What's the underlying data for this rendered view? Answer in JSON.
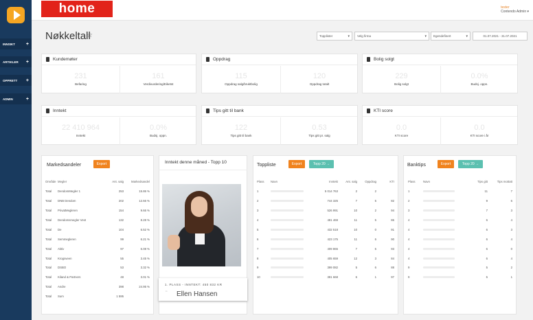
{
  "brand": "home",
  "user": {
    "line1": "tester",
    "line2": "Contendo Admin ▾"
  },
  "sidebar": {
    "items": [
      {
        "label": "INNSIKT",
        "plus": "+"
      },
      {
        "label": "ARTIKLER",
        "plus": "+"
      },
      {
        "label": "OPPRETT",
        "plus": "+"
      },
      {
        "label": "ADMIN",
        "plus": "+"
      }
    ]
  },
  "page": {
    "title": "Nøkkeltall",
    "star": "☆"
  },
  "filters": {
    "toplist": "Topplister",
    "firm": "Velg firma",
    "period": "Egendefinert",
    "date_range": "01.07.2021 - 31.07.2021",
    "caret": "▾"
  },
  "cards": {
    "kundemoter": {
      "title": "Kundemøter",
      "v1": "231",
      "l1": "Befaring",
      "v2": "161",
      "l2": "Verdivurdering/Eiketst"
    },
    "oppdrag": {
      "title": "Oppdrag",
      "v1": "115",
      "l1": "Oppdrag salg/bruktbolig",
      "v2": "120",
      "l2": "Oppdrag totalt"
    },
    "bolig": {
      "title": "Bolig solgt",
      "v1": "229",
      "l1": "Bolig solgt",
      "v2": "0.0%",
      "l2": "Budsj. oppn."
    },
    "inntekt": {
      "title": "Inntekt",
      "v1": "22 410 964",
      "l1": "Inntekt",
      "v2": "0.0%",
      "l2": "Budsj. oppn."
    },
    "tips": {
      "title": "Tips gitt til bank",
      "v1": "122",
      "l1": "Tips gitt til bank",
      "v2": "0.53",
      "l2": "Tips gitt pr. salg"
    },
    "kti": {
      "title": "KTI score",
      "v1": "0.0",
      "l1": "KTI score",
      "v2": "0.0",
      "l2": "KTI score i år"
    }
  },
  "marked": {
    "title": "Markedsandeler",
    "export": "Export",
    "headers": [
      "Område",
      "Megler",
      "Ant. salg",
      "Markedsandel"
    ],
    "rows": [
      [
        "Total",
        "DendomMegler 1",
        "253",
        "15.86 %"
      ],
      [
        "Total",
        "DNB Dendom",
        "202",
        "12.66 %"
      ],
      [
        "Total",
        "PrivatMegleren",
        "154",
        "9.66 %"
      ],
      [
        "Total",
        "Dendomsmegler Vest",
        "132",
        "8.28 %"
      ],
      [
        "Total",
        "De",
        "104",
        "6.52 %"
      ],
      [
        "Total",
        "Semmegleren",
        "99",
        "6.21 %"
      ],
      [
        "Total",
        "Aktiv",
        "97",
        "6.08 %"
      ],
      [
        "Total",
        "Krogsveen",
        "55",
        "3.45 %"
      ],
      [
        "Total",
        "DSBO",
        "53",
        "3.32 %"
      ],
      [
        "Total",
        "Kiland & Partners",
        "48",
        "3.01 %"
      ],
      [
        "Total",
        "Andre",
        "398",
        "24.95 %"
      ],
      [
        "Total",
        "Sum",
        "1 595",
        ""
      ]
    ]
  },
  "monthly": {
    "title": "Inntekt denne måned - Topp 10",
    "place": "1. PLASS - INNTEKT: 450 832 KR",
    "name": "Ellen Hansen",
    "quote": "“"
  },
  "toppliste": {
    "title": "Toppliste",
    "export": "Export",
    "top20": "Topp 20 →",
    "headers": [
      "Plass",
      "Navn",
      "Inntekt",
      "Ant. salg",
      "Oppdrag",
      "KTI"
    ],
    "rows": [
      [
        "1",
        "5 014 763",
        "2",
        "2",
        ""
      ],
      [
        "2",
        "744 325",
        "7",
        "5",
        "82"
      ],
      [
        "3",
        "526 991",
        "10",
        "2",
        "94"
      ],
      [
        "4",
        "481 469",
        "11",
        "5",
        "86"
      ],
      [
        "5",
        "432 518",
        "10",
        "0",
        "91"
      ],
      [
        "6",
        "423 175",
        "11",
        "6",
        "90"
      ],
      [
        "7",
        "409 865",
        "7",
        "5",
        "93"
      ],
      [
        "8",
        "405 659",
        "12",
        "3",
        "84"
      ],
      [
        "9",
        "399 082",
        "5",
        "6",
        "88"
      ],
      [
        "10",
        "381 668",
        "6",
        "1",
        "97"
      ]
    ]
  },
  "banktips": {
    "title": "Banktips",
    "export": "Export",
    "top20": "Topp 20 →",
    "headers": [
      "Plass",
      "Navn",
      "Tips gitt",
      "Tips mottatt"
    ],
    "rows": [
      [
        "1",
        "11",
        "7"
      ],
      [
        "2",
        "9",
        "6"
      ],
      [
        "3",
        "7",
        "3"
      ],
      [
        "4",
        "6",
        "4"
      ],
      [
        "4",
        "6",
        "3"
      ],
      [
        "4",
        "6",
        "4"
      ],
      [
        "4",
        "6",
        "0"
      ],
      [
        "4",
        "6",
        "4"
      ],
      [
        "9",
        "5",
        "2"
      ],
      [
        "9",
        "5",
        "1"
      ]
    ]
  }
}
